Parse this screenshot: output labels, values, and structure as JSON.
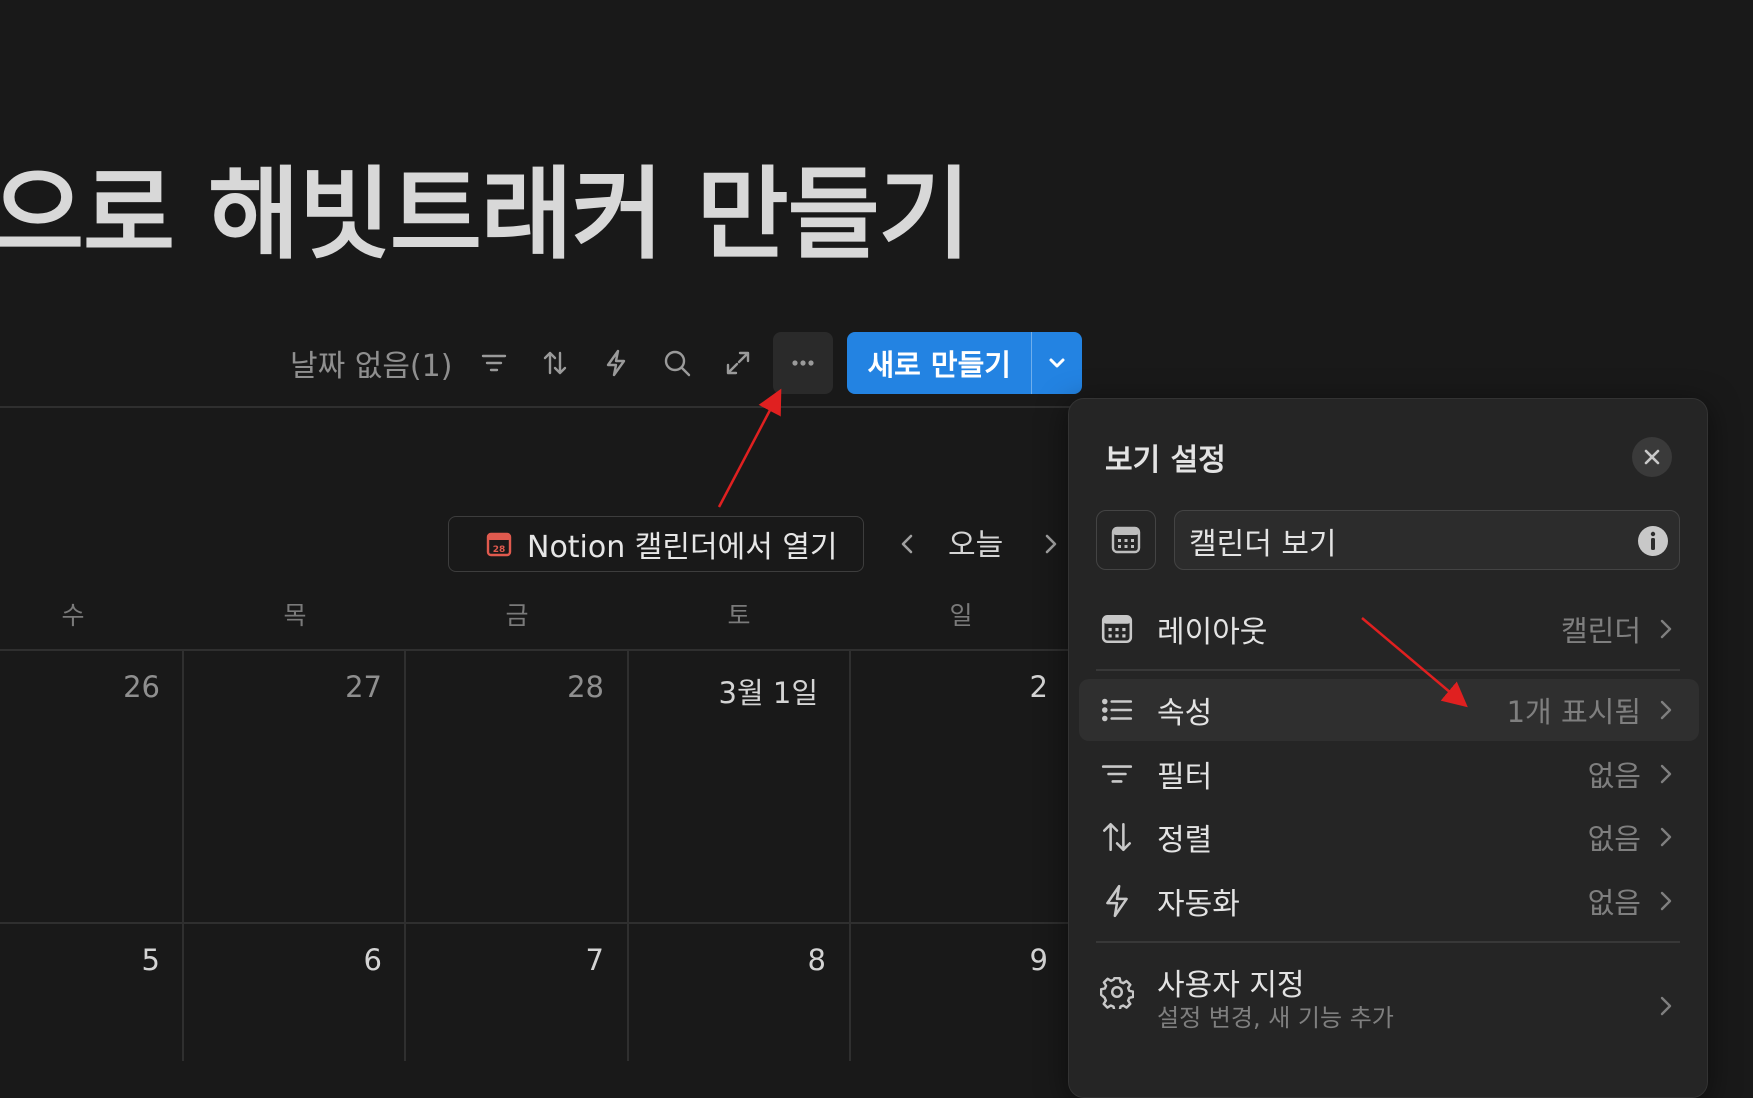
{
  "page": {
    "title": "으로 해빗트래커 만들기"
  },
  "toolbar": {
    "no_date_label": "날짜 없음(1)",
    "new_button_label": "새로 만들기",
    "icons": [
      "filter-icon",
      "sort-icon",
      "lightning-icon",
      "search-icon",
      "expand-icon",
      "more-icon",
      "chevron-down-icon"
    ]
  },
  "calendar": {
    "open_in_calendar_label": "Notion 캘린더에서 열기",
    "today_label": "오늘",
    "weekdays": [
      "수",
      "목",
      "금",
      "토",
      "일"
    ],
    "week1": [
      "26",
      "27",
      "28",
      "3월 1일",
      "2"
    ],
    "week2": [
      "5",
      "6",
      "7",
      "8",
      "9"
    ]
  },
  "panel": {
    "title": "보기 설정",
    "view_name": "캘린더 보기",
    "rows": [
      {
        "label": "레이아웃",
        "value": "캘린더",
        "icon": "calendar-icon"
      },
      {
        "label": "속성",
        "value": "1개 표시됨",
        "icon": "list-icon"
      },
      {
        "label": "필터",
        "value": "없음",
        "icon": "filter-icon"
      },
      {
        "label": "정렬",
        "value": "없음",
        "icon": "sort-icon"
      },
      {
        "label": "자동화",
        "value": "없음",
        "icon": "lightning-icon"
      }
    ],
    "customize": {
      "label": "사용자 지정",
      "sub": "설정 변경, 새 기능 추가",
      "icon": "gear-icon"
    }
  },
  "colors": {
    "accent": "#2383e2",
    "background": "#191919",
    "panel": "#252525",
    "annotation_arrow": "#e02020"
  }
}
